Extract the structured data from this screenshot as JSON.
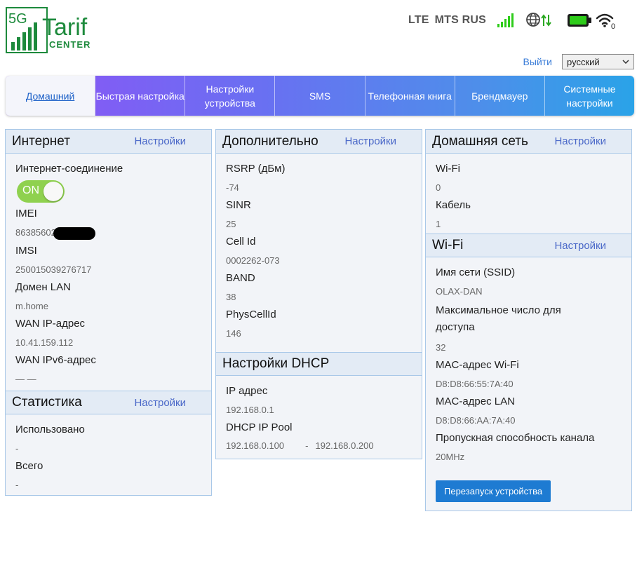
{
  "logo": {
    "prefix": "5G",
    "name": "Tarif",
    "sub": "CENTER",
    "color": "#1d8a3c"
  },
  "status": {
    "network_type": "LTE",
    "operator": "MTS RUS",
    "wifi_clients": "0",
    "signal_color": "#2ecc1a",
    "battery_color": "#2ecc1a"
  },
  "header": {
    "logout": "Выйти",
    "language": "русский"
  },
  "nav": [
    {
      "label": "Домашний"
    },
    {
      "label": "Быстрая настройка"
    },
    {
      "label": "Настройки устройства"
    },
    {
      "label": "SMS"
    },
    {
      "label": "Телефонная книга"
    },
    {
      "label": "Брендмауер"
    },
    {
      "label": "Системные настройки"
    }
  ],
  "internet": {
    "title": "Интернет",
    "settings": "Настройки",
    "connection_label": "Интернет-соединение",
    "toggle": "ON",
    "imei_label": "IMEI",
    "imei_value": "86385602",
    "imsi_label": "IMSI",
    "imsi_value": "250015039276717",
    "lan_domain_label": "Домен LAN",
    "lan_domain_value": "m.home",
    "wan_ip_label": "WAN IP-адрес",
    "wan_ip_value": "10.41.159.112",
    "wan_ipv6_label": "WAN IPv6-адрес",
    "wan_ipv6_value": "— —"
  },
  "statistics": {
    "title": "Статистика",
    "settings": "Настройки",
    "used_label": "Использовано",
    "used_value": "-",
    "total_label": "Всего",
    "total_value": "-"
  },
  "additional": {
    "title": "Дополнительно",
    "settings": "Настройки",
    "rsrp_label": "RSRP (дБм)",
    "rsrp_value": "-74",
    "sinr_label": "SINR",
    "sinr_value": "25",
    "cellid_label": "Cell Id",
    "cellid_value": "0002262-073",
    "band_label": "BAND",
    "band_value": "38",
    "pci_label": "PhysCellId",
    "pci_value": "146"
  },
  "dhcp": {
    "title": "Настройки DHCP",
    "ip_label": "IP адрес",
    "ip_value": "192.168.0.1",
    "pool_label": "DHCP IP Pool",
    "pool_start": "192.168.0.100",
    "pool_sep": "-",
    "pool_end": "192.168.0.200"
  },
  "home_network": {
    "title": "Домашняя сеть",
    "settings": "Настройки",
    "wifi_label": "Wi-Fi",
    "wifi_value": "0",
    "cable_label": "Кабель",
    "cable_value": "1"
  },
  "wifi": {
    "title": "Wi-Fi",
    "settings": "Настройки",
    "ssid_label": "Имя сети (SSID)",
    "ssid_value": "OLAX-DAN",
    "max_label": "Максимальное число для доступа",
    "max_value": "32",
    "mac_wifi_label": "MAC-адрес Wi-Fi",
    "mac_wifi_value": "D8:D8:66:55:7A:40",
    "mac_lan_label": "MAC-адрес LAN",
    "mac_lan_value": "D8:D8:66:AA:7A:40",
    "bandwidth_label": "Пропускная способность канала",
    "bandwidth_value": "20MHz",
    "restart_button": "Перезапуск устройства"
  }
}
